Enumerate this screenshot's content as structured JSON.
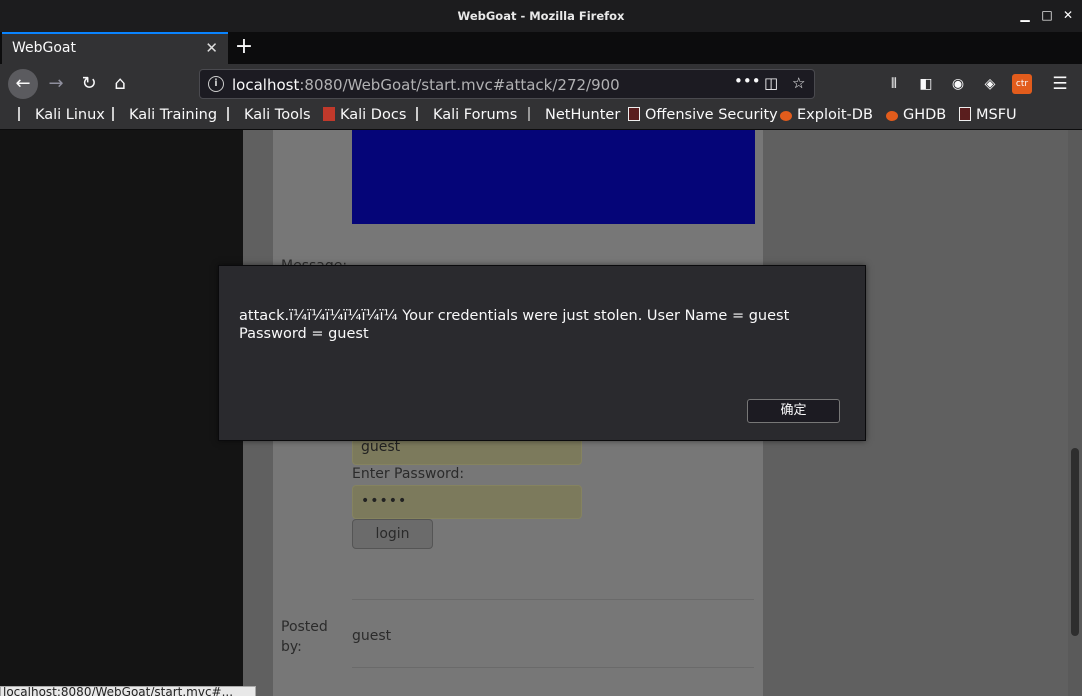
{
  "window": {
    "title": "WebGoat - Mozilla Firefox"
  },
  "tab": {
    "label": "WebGoat"
  },
  "url": {
    "host": "localhost",
    "rest": ":8080/WebGoat/start.mvc#attack/272/900"
  },
  "bookmarks": [
    "Kali Linux",
    "Kali Training",
    "Kali Tools",
    "Kali Docs",
    "Kali Forums",
    "NetHunter",
    "Offensive Security",
    "Exploit-DB",
    "GHDB",
    "MSFU"
  ],
  "page": {
    "message_label": "Message:",
    "username_value": "guest",
    "password_label": "Enter Password:",
    "password_value": "•••••",
    "login_label": "login",
    "posted_by_label": "Posted by:",
    "posted_by_value": "guest",
    "status_text": "localhost:8080/WebGoat/start.mvc#..."
  },
  "dialog": {
    "message": "attack.ï¼ï¼ï¼ï¼ï¼ï¼ Your credentials were just stolen. User Name = guest Password = guest",
    "ok_label": "确定"
  },
  "colors": {
    "accent": "#0a84ff",
    "blue_box": "#050578"
  }
}
